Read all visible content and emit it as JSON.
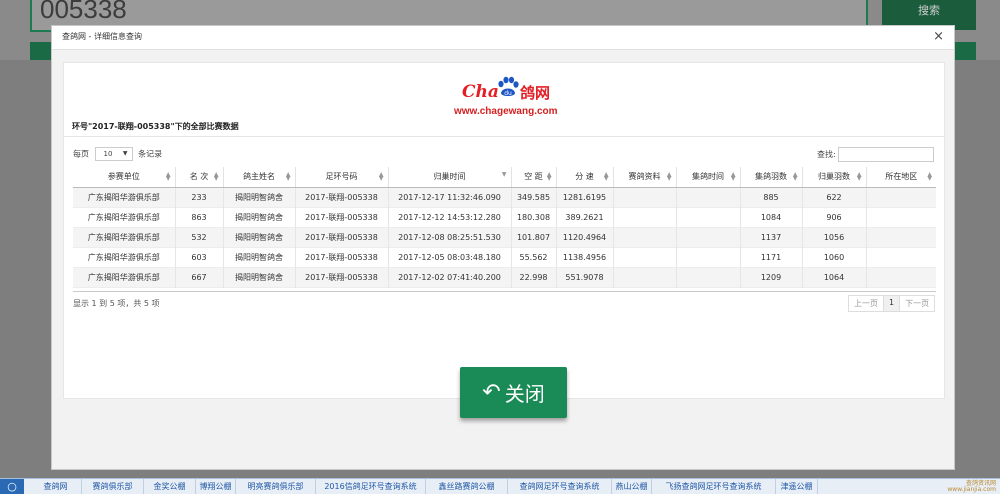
{
  "background": {
    "search_value": "005338",
    "search_button": "搜索"
  },
  "modal": {
    "title": "查鸽网 - 详细信息查询",
    "close_icon": "×",
    "logo": {
      "brand_latin": "Cha",
      "brand_cn": "鸽网",
      "url": "www.chagewang.com"
    },
    "heading": "环号\"2017-联翔-005338\"下的全部比赛数据",
    "length_prefix": "每页",
    "length_value": "10",
    "length_suffix": "条记录",
    "search_label": "查找:",
    "columns": [
      "参赛单位",
      "名 次",
      "鸽主姓名",
      "足环号码",
      "归巢时间",
      "空 距",
      "分 速",
      "赛鸽资料",
      "集鸽时间",
      "集鸽羽数",
      "归巢羽数",
      "所在地区"
    ],
    "rows": [
      [
        "广东揭阳华游俱乐部",
        "233",
        "揭阳明智鸽舍",
        "2017-联翔-005338",
        "2017-12-17 11:32:46.090",
        "349.585",
        "1281.6195",
        "",
        "",
        "885",
        "622",
        ""
      ],
      [
        "广东揭阳华游俱乐部",
        "863",
        "揭阳明智鸽舍",
        "2017-联翔-005338",
        "2017-12-12 14:53:12.280",
        "180.308",
        "389.2621",
        "",
        "",
        "1084",
        "906",
        ""
      ],
      [
        "广东揭阳华游俱乐部",
        "532",
        "揭阳明智鸽舍",
        "2017-联翔-005338",
        "2017-12-08 08:25:51.530",
        "101.807",
        "1120.4964",
        "",
        "",
        "1137",
        "1056",
        ""
      ],
      [
        "广东揭阳华游俱乐部",
        "603",
        "揭阳明智鸽舍",
        "2017-联翔-005338",
        "2017-12-05 08:03:48.180",
        "55.562",
        "1138.4956",
        "",
        "",
        "1171",
        "1060",
        ""
      ],
      [
        "广东揭阳华游俱乐部",
        "667",
        "揭阳明智鸽舍",
        "2017-联翔-005338",
        "2017-12-02 07:41:40.200",
        "22.998",
        "551.9078",
        "",
        "",
        "1209",
        "1064",
        ""
      ]
    ],
    "info": "显示 1 到 5 项，共 5 项",
    "pager": {
      "prev": "上一页",
      "current": "1",
      "next": "下一页"
    },
    "close_button": "关闭"
  },
  "taskbar": {
    "start_icon": "○",
    "links": [
      "查鸽网",
      "赛鸽俱乐部",
      "金奖公棚",
      "博翔公棚",
      "明亮赛鸽俱乐部",
      "2016信鸽足环号查询系统",
      "鑫丝路赛鸽公棚",
      "查鸽网足环号查询系统",
      "燕山公棚",
      "飞扬查鸽网足环号查询系统",
      "津遥公棚"
    ],
    "corner_logo_line1": "查鸽资讯网",
    "corner_logo_line2": "www.jianjia.com"
  }
}
